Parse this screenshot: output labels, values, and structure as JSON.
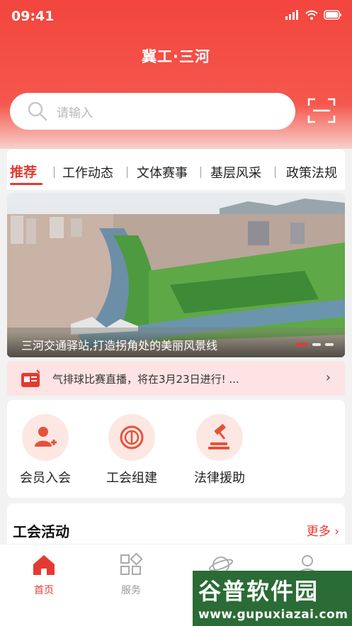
{
  "status_bar": {
    "time": "09:41"
  },
  "header": {
    "title": "冀工·三河"
  },
  "search": {
    "placeholder": "请输入"
  },
  "tabs": [
    {
      "label": "推荐"
    },
    {
      "label": "工作动态"
    },
    {
      "label": "文体赛事"
    },
    {
      "label": "基层风采"
    },
    {
      "label": "政策法规"
    }
  ],
  "banner": {
    "caption": "三河交通驿站,打造拐角处的美丽风景线",
    "active_index": 0,
    "total": 3
  },
  "notice": {
    "text": "气排球比赛直播，将在3月23日进行! ..."
  },
  "services": [
    {
      "label": "会员入会",
      "icon": "member-join-icon"
    },
    {
      "label": "工会组建",
      "icon": "union-build-icon"
    },
    {
      "label": "法律援助",
      "icon": "legal-aid-icon"
    }
  ],
  "activity": {
    "title": "工会活动",
    "more": "更多"
  },
  "tabbar": [
    {
      "label": "首页",
      "icon": "home-icon",
      "active": true
    },
    {
      "label": "服务",
      "icon": "grid-icon",
      "active": false
    },
    {
      "label": "",
      "icon": "planet-icon",
      "active": false
    },
    {
      "label": "",
      "icon": "user-icon",
      "active": false
    }
  ],
  "watermark": {
    "title": "谷普软件园",
    "url": "www.gupuxiazai.com"
  },
  "colors": {
    "brand": "#e53a30",
    "header": "#f2453d",
    "notice_bg": "#fde3e3",
    "watermark_bg": "#2b6b35"
  }
}
